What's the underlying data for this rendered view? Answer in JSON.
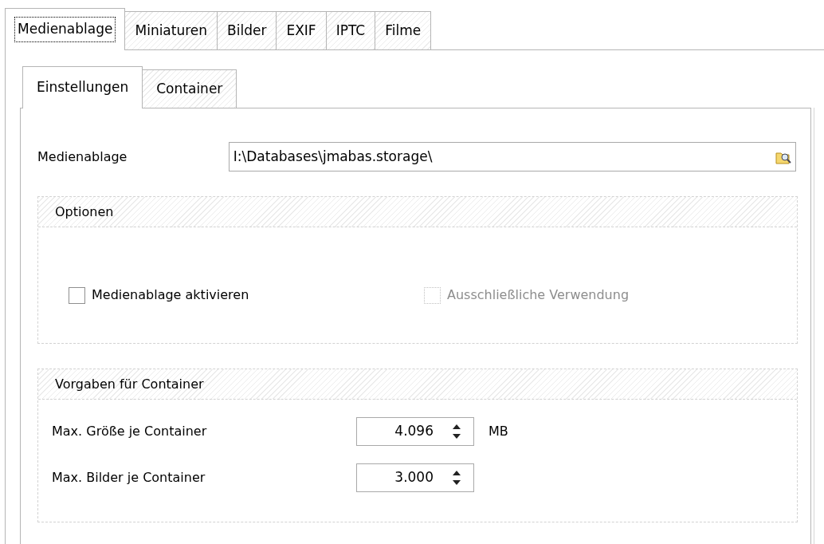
{
  "tabs": [
    {
      "label": "Medienablage",
      "selected": true
    },
    {
      "label": "Miniaturen",
      "selected": false
    },
    {
      "label": "Bilder",
      "selected": false
    },
    {
      "label": "EXIF",
      "selected": false
    },
    {
      "label": "IPTC",
      "selected": false
    },
    {
      "label": "Filme",
      "selected": false
    }
  ],
  "subtabs": [
    {
      "label": "Einstellungen",
      "selected": true
    },
    {
      "label": "Container",
      "selected": false
    }
  ],
  "storage": {
    "label": "Medienablage",
    "value": "I:\\Databases\\jmabas.storage\\"
  },
  "options": {
    "title": "Optionen",
    "checkboxes": [
      {
        "label": "Medienablage aktivieren",
        "checked": false,
        "disabled": false
      },
      {
        "label": "Ausschließliche Verwendung",
        "checked": false,
        "disabled": true
      }
    ]
  },
  "container_defaults": {
    "title": "Vorgaben für Container",
    "rows": [
      {
        "label": "Max. Größe je Container",
        "value": "4.096",
        "unit": "MB"
      },
      {
        "label": "Max. Bilder je Container",
        "value": "3.000"
      }
    ]
  }
}
